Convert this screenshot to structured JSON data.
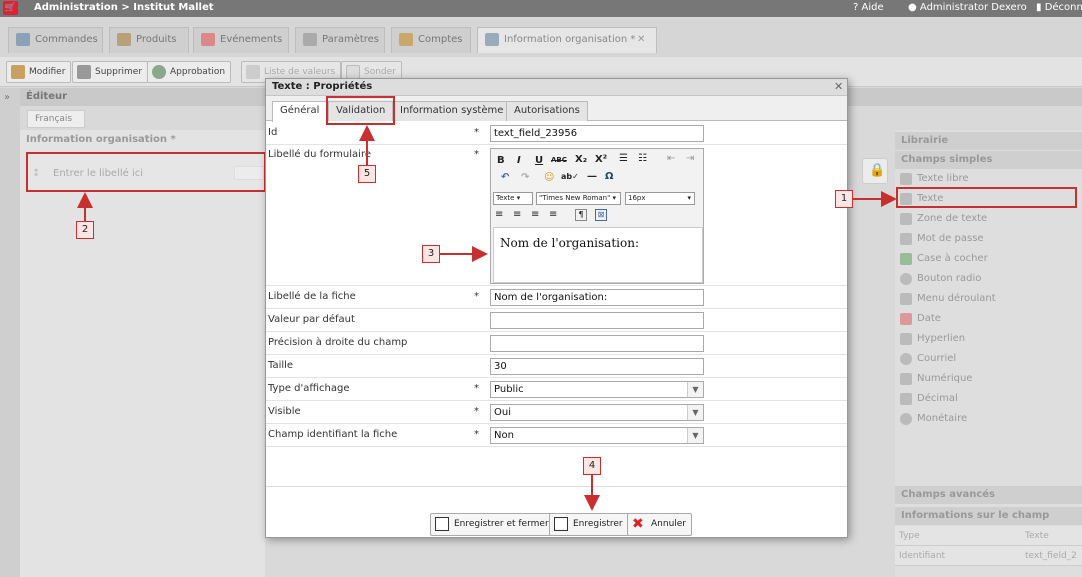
{
  "app": {
    "breadcrumb": "Administration > Institut Mallet",
    "help": "Aide",
    "user": "Administrator Dexero",
    "logout": "Déconn"
  },
  "main_tabs": [
    {
      "label": "Commandes"
    },
    {
      "label": "Produits"
    },
    {
      "label": "Evénements"
    },
    {
      "label": "Paramètres"
    },
    {
      "label": "Comptes"
    },
    {
      "label": "Information organisation *"
    }
  ],
  "toolbar": {
    "modify": "Modifier",
    "delete": "Supprimer",
    "approve": "Approbation",
    "values_list": "Liste de valeurs",
    "survey": "Sonder"
  },
  "editor": {
    "title": "Éditeur",
    "lang_tab": "Français",
    "panel_title": "Information organisation *",
    "field_placeholder": "Entrer le libellé ici"
  },
  "library": {
    "title": "Librairie",
    "simple_fields": "Champs simples",
    "items": [
      {
        "label": "Texte libre"
      },
      {
        "label": "Texte"
      },
      {
        "label": "Zone de texte"
      },
      {
        "label": "Mot de passe"
      },
      {
        "label": "Case à cocher"
      },
      {
        "label": "Bouton radio"
      },
      {
        "label": "Menu déroulant"
      },
      {
        "label": "Date"
      },
      {
        "label": "Hyperlien"
      },
      {
        "label": "Courriel"
      },
      {
        "label": "Numérique"
      },
      {
        "label": "Décimal"
      },
      {
        "label": "Monétaire"
      }
    ],
    "advanced_fields": "Champs avancés",
    "field_info": "Informations sur le champ",
    "info_rows": [
      {
        "key": "Type",
        "value": "Texte"
      },
      {
        "key": "Identifiant",
        "value": "text_field_2"
      }
    ]
  },
  "dialog": {
    "title": "Texte : Propriétés",
    "close": "✕",
    "tabs": [
      {
        "label": "Général"
      },
      {
        "label": "Validation"
      },
      {
        "label": "Information système"
      },
      {
        "label": "Autorisations"
      }
    ],
    "required_mark": "*",
    "fields": {
      "id": {
        "label": "Id",
        "value": "text_field_23956"
      },
      "form_label": {
        "label": "Libellé du formulaire",
        "rich_text": "Nom de l'organisation:"
      },
      "sheet_label": {
        "label": "Libellé de la fiche",
        "value": "Nom de l'organisation:"
      },
      "default_value": {
        "label": "Valeur par défaut",
        "value": ""
      },
      "precision": {
        "label": "Précision à droite du champ",
        "value": ""
      },
      "size": {
        "label": "Taille",
        "value": "30"
      },
      "display_type": {
        "label": "Type d'affichage",
        "value": "Public"
      },
      "visible": {
        "label": "Visible",
        "value": "Oui"
      },
      "identifier": {
        "label": "Champ identifiant la fiche",
        "value": "Non"
      }
    },
    "rte": {
      "format": "Texte",
      "font": "\"Times New Roman\"",
      "size": "16px",
      "btn_bold": "B",
      "btn_italic": "I",
      "btn_underline": "U",
      "btn_strike": "ABC",
      "btn_sub": "X₂",
      "btn_sup": "X²",
      "btn_omega": "Ω"
    },
    "buttons": {
      "save_close": "Enregistrer et fermer",
      "save": "Enregistrer",
      "cancel": "Annuler"
    }
  },
  "callouts": {
    "c1": "1",
    "c2": "2",
    "c3": "3",
    "c4": "4",
    "c5": "5"
  },
  "colors": {
    "highlight": "#c83030"
  }
}
